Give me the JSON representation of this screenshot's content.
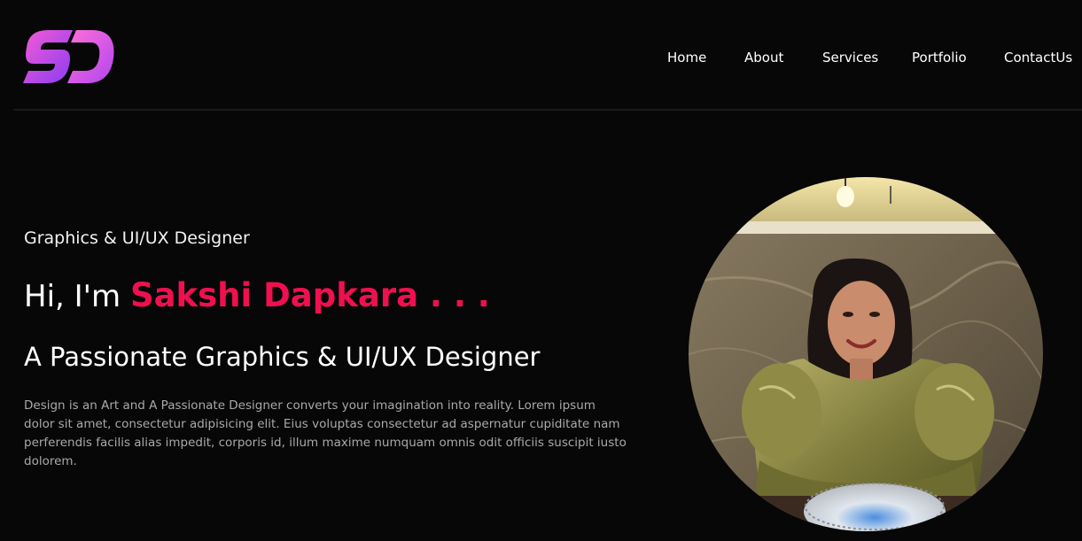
{
  "brand": {
    "logo_text": "SD",
    "gradient_start": "#f45bd6",
    "gradient_end": "#8a3cf2"
  },
  "nav": {
    "items": [
      {
        "label": "Home"
      },
      {
        "label": "About"
      },
      {
        "label": "Services"
      },
      {
        "label": "Portfolio"
      },
      {
        "label": "ContactUs"
      }
    ]
  },
  "hero": {
    "subtitle": "Graphics & UI/UX Designer",
    "greeting": "Hi, I'm ",
    "name": "Sakshi Dapkara . . .",
    "tagline": "A Passionate Graphics & UI/UX Designer",
    "description": "Design is an Art and A Passionate Designer converts your imagination into reality. Lorem ipsum dolor sit amet, consectetur adipisicing elit. Eius voluptas consectetur ad aspernatur cupiditate nam perferendis facilis alias impedit, corporis id, illum maxime numquam omnis odit officiis suscipit iusto dolorem."
  },
  "colors": {
    "accent": "#f0104f",
    "background": "#070707"
  }
}
